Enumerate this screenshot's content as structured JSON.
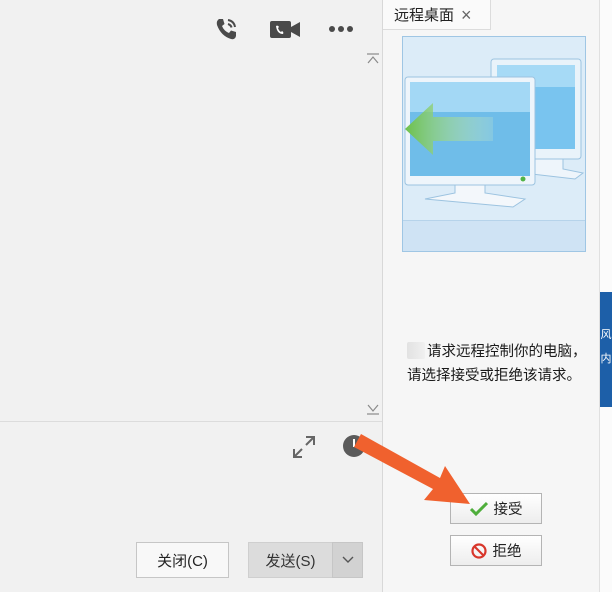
{
  "chat": {
    "send_label": "发送(S)",
    "close_label": "关闭(C)"
  },
  "remote_panel": {
    "tab_title": "远程桌面",
    "tab_close": "×",
    "request_message": "请求远程控制你的电脑，请选择接受或拒绝该请求。",
    "accept_label": "接受",
    "reject_label": "拒绝"
  },
  "edge": {
    "text_top": "风",
    "text_bottom": "内"
  },
  "colors": {
    "annotation_arrow": "#f0612e",
    "accent_blue": "#1d5fa8"
  }
}
